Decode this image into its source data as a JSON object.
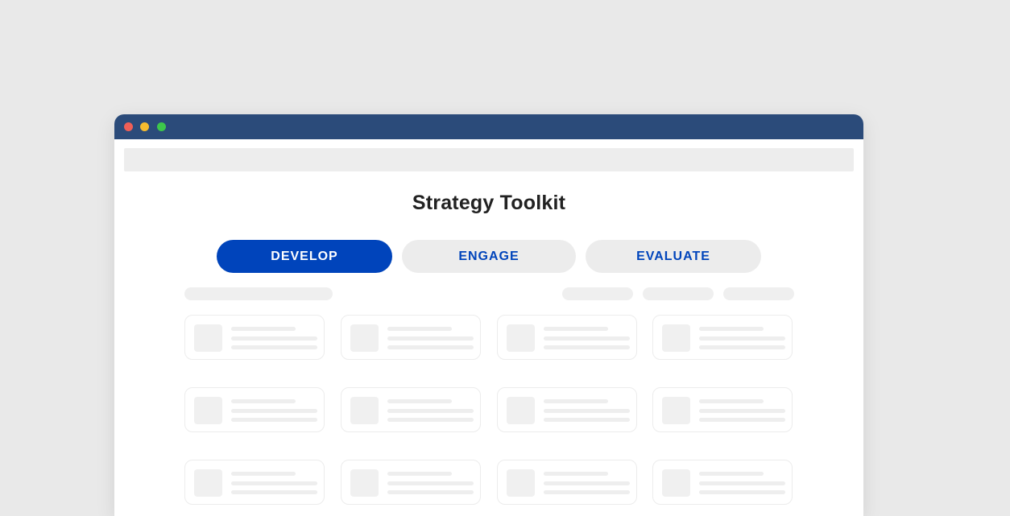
{
  "window": {
    "controls": [
      {
        "name": "close",
        "color": "#ef5f57"
      },
      {
        "name": "minimize",
        "color": "#f6bc2f"
      },
      {
        "name": "maximize",
        "color": "#3dc74b"
      }
    ],
    "titlebar_color": "#2b4b7a"
  },
  "page": {
    "title": "Strategy Toolkit"
  },
  "tabs": [
    {
      "label": "DEVELOP",
      "active": true
    },
    {
      "label": "ENGAGE",
      "active": false
    },
    {
      "label": "EVALUATE",
      "active": false
    }
  ],
  "colors": {
    "accent": "#0044bb",
    "tab_inactive_text": "#0044bb",
    "tab_inactive_bg": "#ececec"
  },
  "grid": {
    "rows": 3,
    "columns": 4
  }
}
